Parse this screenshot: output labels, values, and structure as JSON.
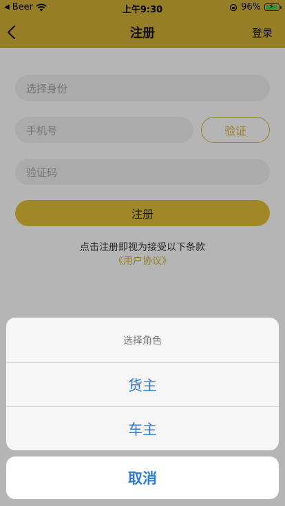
{
  "status_bar": {
    "carrier": "Beer",
    "time": "上午9:30",
    "battery": "96%"
  },
  "nav": {
    "title": "注册",
    "login": "登录"
  },
  "form": {
    "role_placeholder": "选择身份",
    "phone_placeholder": "手机号",
    "verify_label": "验证",
    "code_placeholder": "验证码",
    "register_label": "注册",
    "terms_text": "点击注册即视为接受以下条款",
    "terms_link": "《用户协议》"
  },
  "action_sheet": {
    "title": "选择角色",
    "options": [
      "货主",
      "车主"
    ],
    "cancel": "取消"
  },
  "colors": {
    "accent": "#c9a834",
    "button": "#d7b635",
    "sheet_action": "#2d7bd8"
  }
}
